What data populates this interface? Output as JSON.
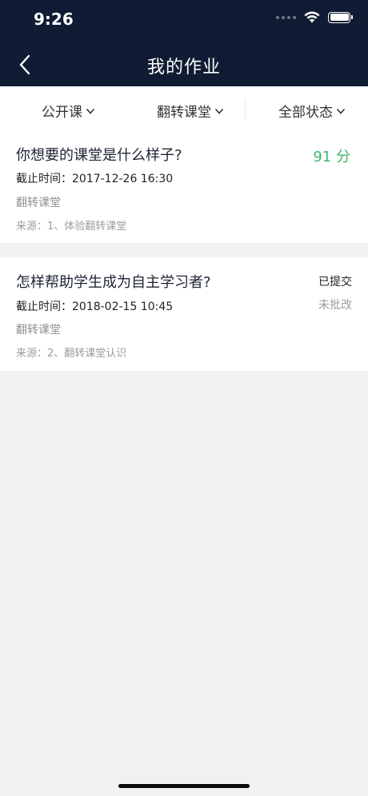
{
  "status_bar": {
    "time": "9:26"
  },
  "header": {
    "title": "我的作业"
  },
  "filters": [
    {
      "label": "公开课"
    },
    {
      "label": "翻转课堂"
    },
    {
      "label": "全部状态"
    }
  ],
  "assignments": [
    {
      "title": "你想要的课堂是什么样子?",
      "deadline": "截止时间：2017-12-26 16:30",
      "course": "翻转课堂",
      "source": "来源：1、体验翻转课堂",
      "score": "91 分"
    },
    {
      "title": "怎样帮助学生成为自主学习者?",
      "deadline": "截止时间：2018-02-15 10:45",
      "course": "翻转课堂",
      "source": "来源：2、翻转课堂认识",
      "status_submitted": "已提交",
      "status_graded": "未批改"
    }
  ],
  "colors": {
    "header_bg": "#0f1c33",
    "score_green": "#3bb86a",
    "page_bg": "#f0f1f3"
  }
}
